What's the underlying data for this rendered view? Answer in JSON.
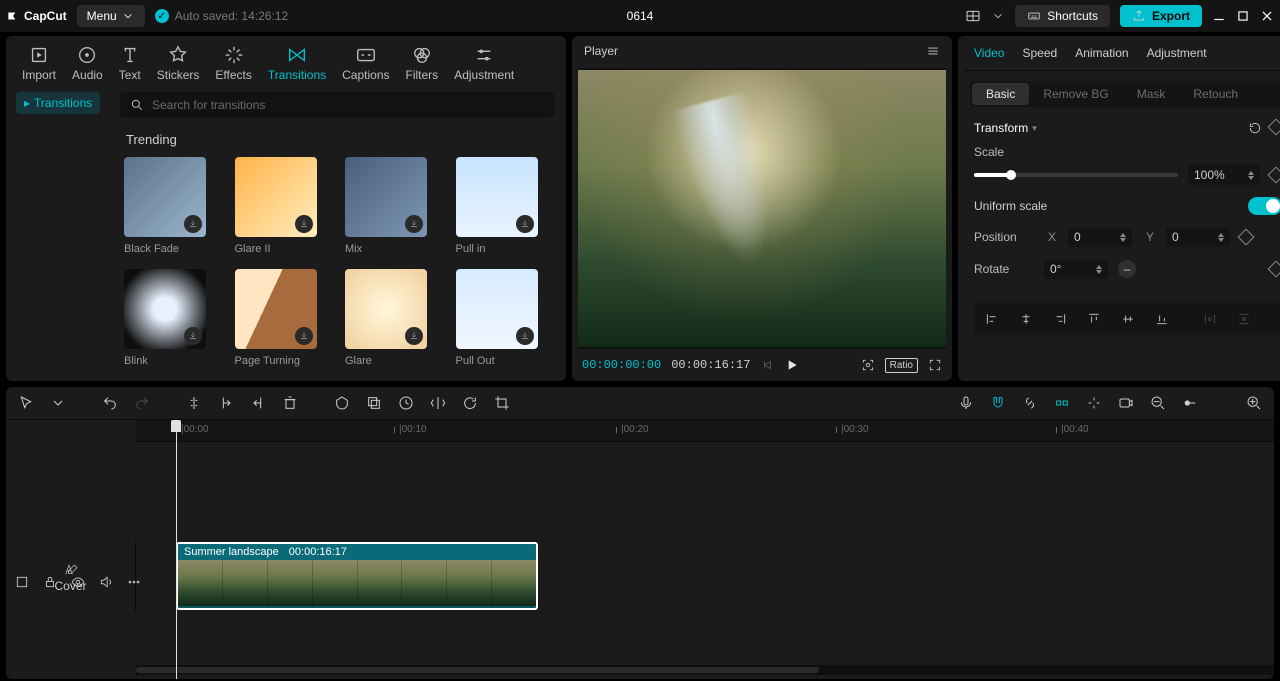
{
  "app": {
    "brand": "CapCut",
    "menu_label": "Menu",
    "autosave_label": "Auto saved: 14:26:12",
    "project_name": "0614",
    "shortcuts_label": "Shortcuts",
    "export_label": "Export"
  },
  "left_tabs": [
    {
      "label": "Import",
      "icon": "import"
    },
    {
      "label": "Audio",
      "icon": "audio"
    },
    {
      "label": "Text",
      "icon": "text"
    },
    {
      "label": "Stickers",
      "icon": "stickers"
    },
    {
      "label": "Effects",
      "icon": "effects"
    },
    {
      "label": "Transitions",
      "icon": "transitions",
      "active": true
    },
    {
      "label": "Captions",
      "icon": "captions"
    },
    {
      "label": "Filters",
      "icon": "filters"
    },
    {
      "label": "Adjustment",
      "icon": "adjustment"
    }
  ],
  "left_side": {
    "item": "Transitions"
  },
  "search": {
    "placeholder": "Search for transitions"
  },
  "trending": {
    "title": "Trending",
    "items": [
      {
        "label": "Black Fade",
        "key": "blackfade"
      },
      {
        "label": "Glare II",
        "key": "glare2"
      },
      {
        "label": "Mix",
        "key": "mix"
      },
      {
        "label": "Pull in",
        "key": "pullin"
      },
      {
        "label": "Blink",
        "key": "blink"
      },
      {
        "label": "Page Turning",
        "key": "pageturn"
      },
      {
        "label": "Glare",
        "key": "glare"
      },
      {
        "label": "Pull Out",
        "key": "pullout"
      }
    ]
  },
  "player": {
    "title": "Player",
    "tc_now": "00:00:00:00",
    "tc_dur": "00:00:16:17",
    "ratio_label": "Ratio"
  },
  "inspector": {
    "tabs": [
      {
        "label": "Video",
        "active": true
      },
      {
        "label": "Speed"
      },
      {
        "label": "Animation"
      },
      {
        "label": "Adjustment"
      }
    ],
    "subtabs": [
      {
        "label": "Basic",
        "active": true
      },
      {
        "label": "Remove BG"
      },
      {
        "label": "Mask"
      },
      {
        "label": "Retouch"
      }
    ],
    "transform": {
      "title": "Transform",
      "scale_label": "Scale",
      "scale_value": "100%",
      "uniform_label": "Uniform scale",
      "uniform_on": true,
      "position_label": "Position",
      "pos_x_label": "X",
      "pos_x_value": "0",
      "pos_y_label": "Y",
      "pos_y_value": "0",
      "rotate_label": "Rotate",
      "rotate_value": "0°"
    }
  },
  "ruler_ticks": [
    "|00:00",
    "|00:10",
    "|00:20",
    "|00:30",
    "|00:40"
  ],
  "clip": {
    "name": "Summer landscape",
    "dur": "00:00:16:17"
  },
  "cover_label": "Cover"
}
